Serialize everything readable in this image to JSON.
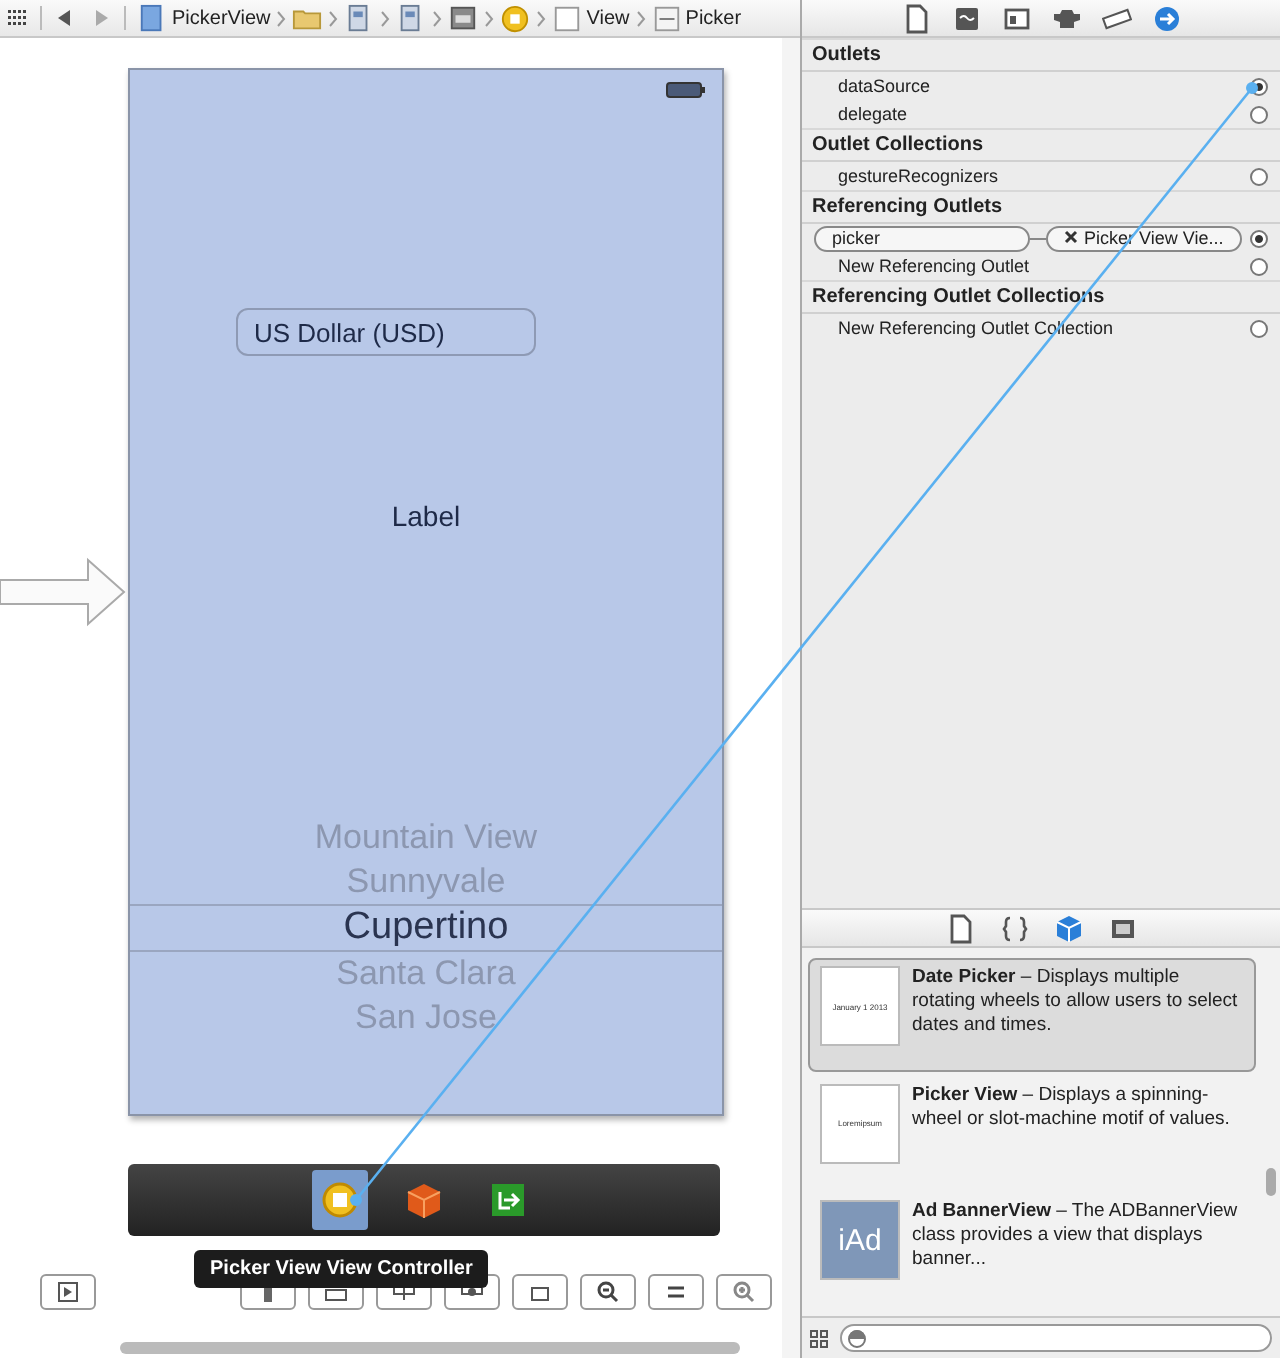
{
  "breadcrumb": [
    {
      "kind": "file",
      "text": "PickerView"
    },
    {
      "kind": "folder"
    },
    {
      "kind": "storyboard"
    },
    {
      "kind": "storyboard"
    },
    {
      "kind": "scene"
    },
    {
      "kind": "controller"
    },
    {
      "kind": "view",
      "text": "View"
    },
    {
      "kind": "picker",
      "text": "Picker"
    }
  ],
  "phone": {
    "text_field": {
      "value": "US Dollar (USD)"
    },
    "label": "Label",
    "picker": [
      {
        "text": "Mountain View",
        "selected": false
      },
      {
        "text": "Sunnyvale",
        "selected": false
      },
      {
        "text": "Cupertino",
        "selected": true
      },
      {
        "text": "Santa Clara",
        "selected": false
      },
      {
        "text": "San Jose",
        "selected": false
      }
    ]
  },
  "dock": [
    {
      "kind": "controller",
      "selected": true
    },
    {
      "kind": "cube",
      "selected": false
    },
    {
      "kind": "exit",
      "selected": false
    }
  ],
  "tooltip": "Picker View View Controller",
  "inspector_tabs": [
    {
      "kind": "file",
      "selected": false
    },
    {
      "kind": "help",
      "selected": false
    },
    {
      "kind": "identity",
      "selected": false
    },
    {
      "kind": "attributes",
      "selected": false
    },
    {
      "kind": "size",
      "selected": false
    },
    {
      "kind": "connections",
      "selected": true
    }
  ],
  "sections": [
    {
      "title": "Outlets",
      "rows": [
        {
          "kind": "outlet",
          "name": "dataSource",
          "connected": true
        },
        {
          "kind": "outlet",
          "name": "delegate",
          "connected": false
        }
      ]
    },
    {
      "title": "Outlet Collections",
      "rows": [
        {
          "kind": "outlet",
          "name": "gestureRecognizers",
          "connected": false
        }
      ]
    },
    {
      "title": "Referencing Outlets",
      "rows": [
        {
          "kind": "connection",
          "name": "picker",
          "target": "Picker View Vie...",
          "connected": true
        },
        {
          "kind": "outlet",
          "name": "New Referencing Outlet",
          "connected": false
        }
      ]
    },
    {
      "title": "Referencing Outlet Collections",
      "rows": [
        {
          "kind": "outlet",
          "name": "New Referencing Outlet Collection",
          "connected": false
        }
      ]
    }
  ],
  "library_tabs": [
    {
      "kind": "file",
      "selected": false
    },
    {
      "kind": "braces",
      "selected": false
    },
    {
      "kind": "cube",
      "selected": true
    },
    {
      "kind": "media",
      "selected": false
    }
  ],
  "library": [
    {
      "kind": "date",
      "thumb_text": "January 1 2013",
      "text": "**Date Picker** – Displays multiple rotating wheels to allow users to select dates and times.",
      "selected": true
    },
    {
      "kind": "picker",
      "thumb_text": "Loremipsum",
      "text": "**Picker View** – Displays a spinning-wheel or slot-machine motif of values.",
      "selected": false
    },
    {
      "kind": "iad",
      "thumb_text": "iAd",
      "text": "**Ad BannerView** – The ADBannerView class provides a view that displays banner...",
      "selected": false
    }
  ]
}
